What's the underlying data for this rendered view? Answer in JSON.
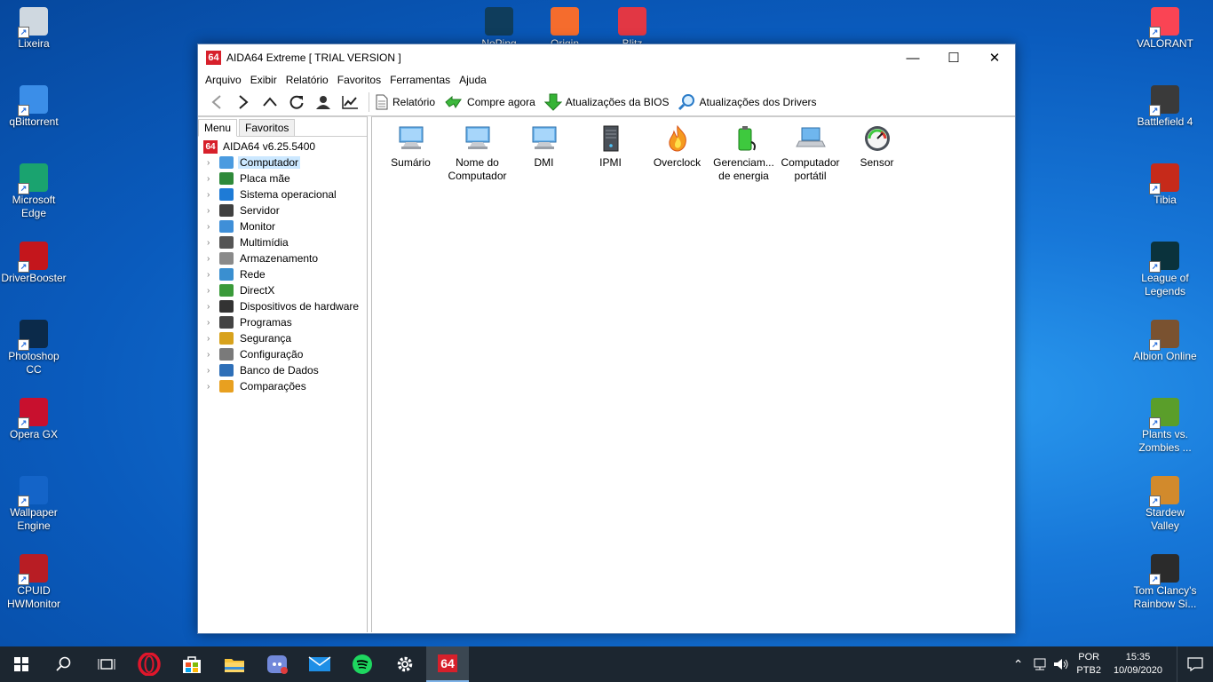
{
  "desktop_left": [
    {
      "label": "Lixeira",
      "icon": "recycle-bin-icon",
      "color": "#cfd8e0"
    },
    {
      "label": "qBittorrent",
      "icon": "qbittorrent-icon",
      "color": "#3b8ee8"
    },
    {
      "label": "Microsoft Edge",
      "icon": "edge-icon",
      "color": "#1aa36f"
    },
    {
      "label": "DriverBooster",
      "icon": "driverbooster-icon",
      "color": "#c4161c"
    },
    {
      "label": "Photoshop CC",
      "icon": "photoshop-icon",
      "color": "#0b2a4a"
    },
    {
      "label": "Opera GX",
      "icon": "opera-gx-icon",
      "color": "#c8102e"
    },
    {
      "label": "Wallpaper Engine",
      "icon": "wallpaper-engine-icon",
      "color": "#1464c8"
    },
    {
      "label": "CPUID HWMonitor",
      "icon": "hwmonitor-icon",
      "color": "#b81d24"
    }
  ],
  "desktop_top": [
    {
      "label": "NoPing",
      "icon": "noping-icon",
      "color": "#0f3d5c"
    },
    {
      "label": "Origin",
      "icon": "origin-icon",
      "color": "#f56c2d"
    },
    {
      "label": "Blitz",
      "icon": "blitz-icon",
      "color": "#e23744"
    }
  ],
  "desktop_right": [
    {
      "label": "VALORANT",
      "icon": "valorant-icon",
      "color": "#fa4454"
    },
    {
      "label": "Battlefield 4",
      "icon": "battlefield-icon",
      "color": "#3a3a3a"
    },
    {
      "label": "Tibia",
      "icon": "tibia-icon",
      "color": "#c62a1a"
    },
    {
      "label": "League of Legends",
      "icon": "league-icon",
      "color": "#0a323c"
    },
    {
      "label": "Albion Online",
      "icon": "albion-icon",
      "color": "#7a5230"
    },
    {
      "label": "Plants vs. Zombies ...",
      "icon": "pvz-icon",
      "color": "#5a9e2a"
    },
    {
      "label": "Stardew Valley",
      "icon": "stardew-icon",
      "color": "#d28a2c"
    },
    {
      "label": "Tom Clancy's Rainbow Si...",
      "icon": "rainbow-six-icon",
      "color": "#2b2b2b"
    }
  ],
  "window": {
    "badge": "64",
    "title": "AIDA64 Extreme  [ TRIAL VERSION ]",
    "minimize": "—",
    "maximize": "☐",
    "close": "✕"
  },
  "menu": [
    "Arquivo",
    "Exibir",
    "Relatório",
    "Favoritos",
    "Ferramentas",
    "Ajuda"
  ],
  "toolbar": {
    "report": "Relatório",
    "buy": "Compre agora",
    "bios": "Atualizações da BIOS",
    "drivers": "Atualizações dos Drivers"
  },
  "tabs": {
    "menu": "Menu",
    "favorites": "Favoritos"
  },
  "tree_root": {
    "badge": "64",
    "label": "AIDA64 v6.25.5400"
  },
  "tree": [
    {
      "label": "Computador",
      "icon": "computer-icon",
      "color": "#4a9be0"
    },
    {
      "label": "Placa mãe",
      "icon": "motherboard-icon",
      "color": "#2f8a3a"
    },
    {
      "label": "Sistema operacional",
      "icon": "windows-icon",
      "color": "#1e7bd6"
    },
    {
      "label": "Servidor",
      "icon": "server-icon",
      "color": "#404040"
    },
    {
      "label": "Monitor",
      "icon": "monitor-icon",
      "color": "#3f8fd8"
    },
    {
      "label": "Multimídia",
      "icon": "speaker-icon",
      "color": "#555555"
    },
    {
      "label": "Armazenamento",
      "icon": "storage-icon",
      "color": "#8a8a8a"
    },
    {
      "label": "Rede",
      "icon": "network-icon",
      "color": "#3a8fd0"
    },
    {
      "label": "DirectX",
      "icon": "directx-icon",
      "color": "#3a9a3a"
    },
    {
      "label": "Dispositivos de hardware",
      "icon": "hardware-icon",
      "color": "#333333"
    },
    {
      "label": "Programas",
      "icon": "programs-icon",
      "color": "#444444"
    },
    {
      "label": "Segurança",
      "icon": "shield-icon",
      "color": "#d8a21c"
    },
    {
      "label": "Configuração",
      "icon": "config-icon",
      "color": "#7a7a7a"
    },
    {
      "label": "Banco de Dados",
      "icon": "database-icon",
      "color": "#2e6fb8"
    },
    {
      "label": "Comparações",
      "icon": "benchmark-icon",
      "color": "#e8a020"
    }
  ],
  "content_icons": [
    {
      "line1": "Sumário",
      "line2": "",
      "icon": "summary-icon"
    },
    {
      "line1": "Nome do",
      "line2": "Computador",
      "icon": "computer-name-icon"
    },
    {
      "line1": "DMI",
      "line2": "",
      "icon": "dmi-icon"
    },
    {
      "line1": "IPMI",
      "line2": "",
      "icon": "ipmi-icon"
    },
    {
      "line1": "Overclock",
      "line2": "",
      "icon": "overclock-icon"
    },
    {
      "line1": "Gerenciam...",
      "line2": "de energia",
      "icon": "power-management-icon"
    },
    {
      "line1": "Computador",
      "line2": "portátil",
      "icon": "laptop-icon"
    },
    {
      "line1": "Sensor",
      "line2": "",
      "icon": "sensor-icon"
    }
  ],
  "taskbar": {
    "apps": [
      "start-icon",
      "search-icon",
      "task-view-icon",
      "opera-icon",
      "store-icon",
      "explorer-icon",
      "discord-icon",
      "mail-icon",
      "spotify-icon",
      "settings-icon",
      "aida64-icon"
    ],
    "lang1": "POR",
    "lang2": "PTB2",
    "time": "15:35",
    "date": "10/09/2020"
  }
}
